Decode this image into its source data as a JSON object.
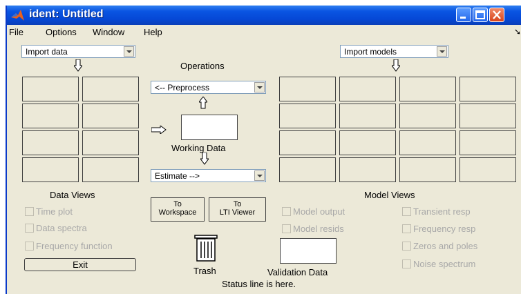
{
  "window": {
    "title": "ident: Untitled"
  },
  "menu": {
    "items": [
      "File",
      "Options",
      "Window",
      "Help"
    ]
  },
  "import_data": {
    "value": "Import data"
  },
  "import_models": {
    "value": "Import models"
  },
  "operations": {
    "label": "Operations",
    "preprocess": "<-- Preprocess",
    "estimate": "Estimate -->",
    "working_data": "Working Data"
  },
  "data_views": {
    "title": "Data Views",
    "checkboxes": [
      "Time plot",
      "Data spectra",
      "Frequency function"
    ]
  },
  "model_views": {
    "title": "Model Views",
    "checkboxes_left": [
      "Model output",
      "Model resids"
    ],
    "checkboxes_right": [
      "Transient resp",
      "Frequency resp",
      "Zeros and poles",
      "Noise spectrum"
    ]
  },
  "buttons": {
    "to_workspace": [
      "To",
      "Workspace"
    ],
    "to_lti": [
      "To",
      "LTI Viewer"
    ],
    "exit": "Exit"
  },
  "trash": {
    "label": "Trash"
  },
  "validation": {
    "label": "Validation Data"
  },
  "status": {
    "text": "Status line is here."
  }
}
